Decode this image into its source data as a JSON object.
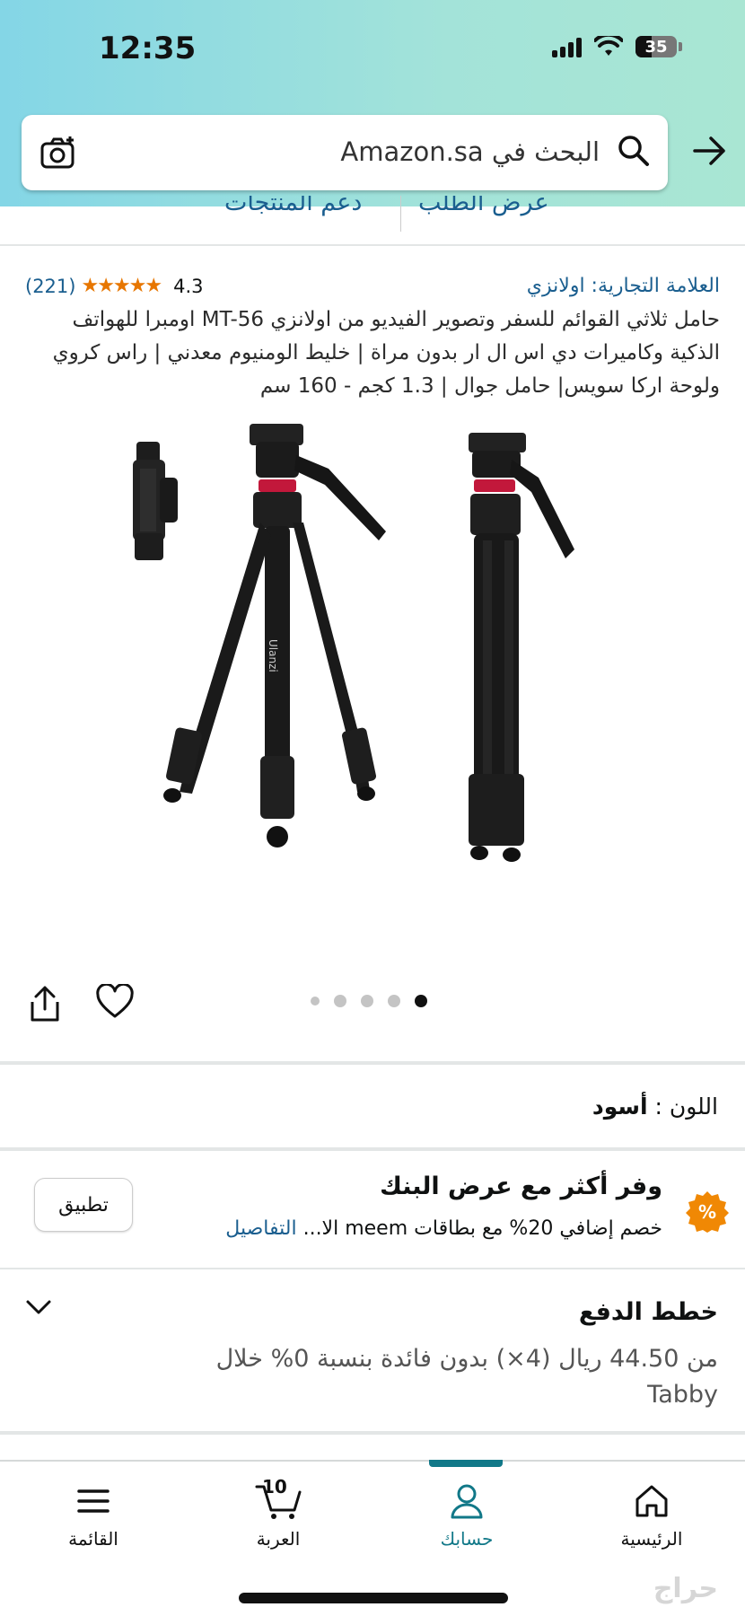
{
  "status_bar": {
    "time": "12:35",
    "battery": "35"
  },
  "search": {
    "placeholder": "البحث في Amazon.sa"
  },
  "breadcrumb": {
    "left": "دعم المنتجات",
    "right": "عرض الطلب"
  },
  "product": {
    "brand": "العلامة التجارية: اولانزي",
    "rating": "4.3",
    "stars": "★★★★★",
    "review_count": "(221)",
    "title": "حامل ثلاثي القوائم للسفر وتصوير الفيديو من اولانزي MT-56 اومبرا للهواتف الذكية وكاميرات دي اس ال ار بدون مراة | خليط الومنيوم معدني | راس كروي ولوحة اركا سويس| حامل جوال | 1.3 كجم - 160 سم",
    "image_label": "Ulanzi",
    "image_count": 5,
    "active_image": 5
  },
  "color": {
    "label": "اللون :",
    "value": "أسود"
  },
  "bank_offer": {
    "title": "وفر أكثر مع عرض البنك",
    "description": "خصم إضافي 20% مع بطاقات meem الا...",
    "details_link": "التفاصيل",
    "apply_label": "تطبيق",
    "icon_text": "%"
  },
  "payment_plans": {
    "title": "خطط الدفع",
    "description": "من 44.50 ريال (4×) بدون فائدة بنسبة 0% خلال Tabby"
  },
  "bottom_nav": {
    "items": [
      {
        "label": "الرئيسية",
        "icon": "home-icon"
      },
      {
        "label": "حسابك",
        "icon": "account-icon",
        "active": true
      },
      {
        "label": "العربة",
        "icon": "cart-icon",
        "count": "10"
      },
      {
        "label": "القائمة",
        "icon": "menu-icon"
      }
    ]
  },
  "colors": {
    "accent": "#117888",
    "link": "#1a5e8f",
    "star": "#e77600",
    "offer": "#f08804"
  },
  "watermark": "حراج"
}
